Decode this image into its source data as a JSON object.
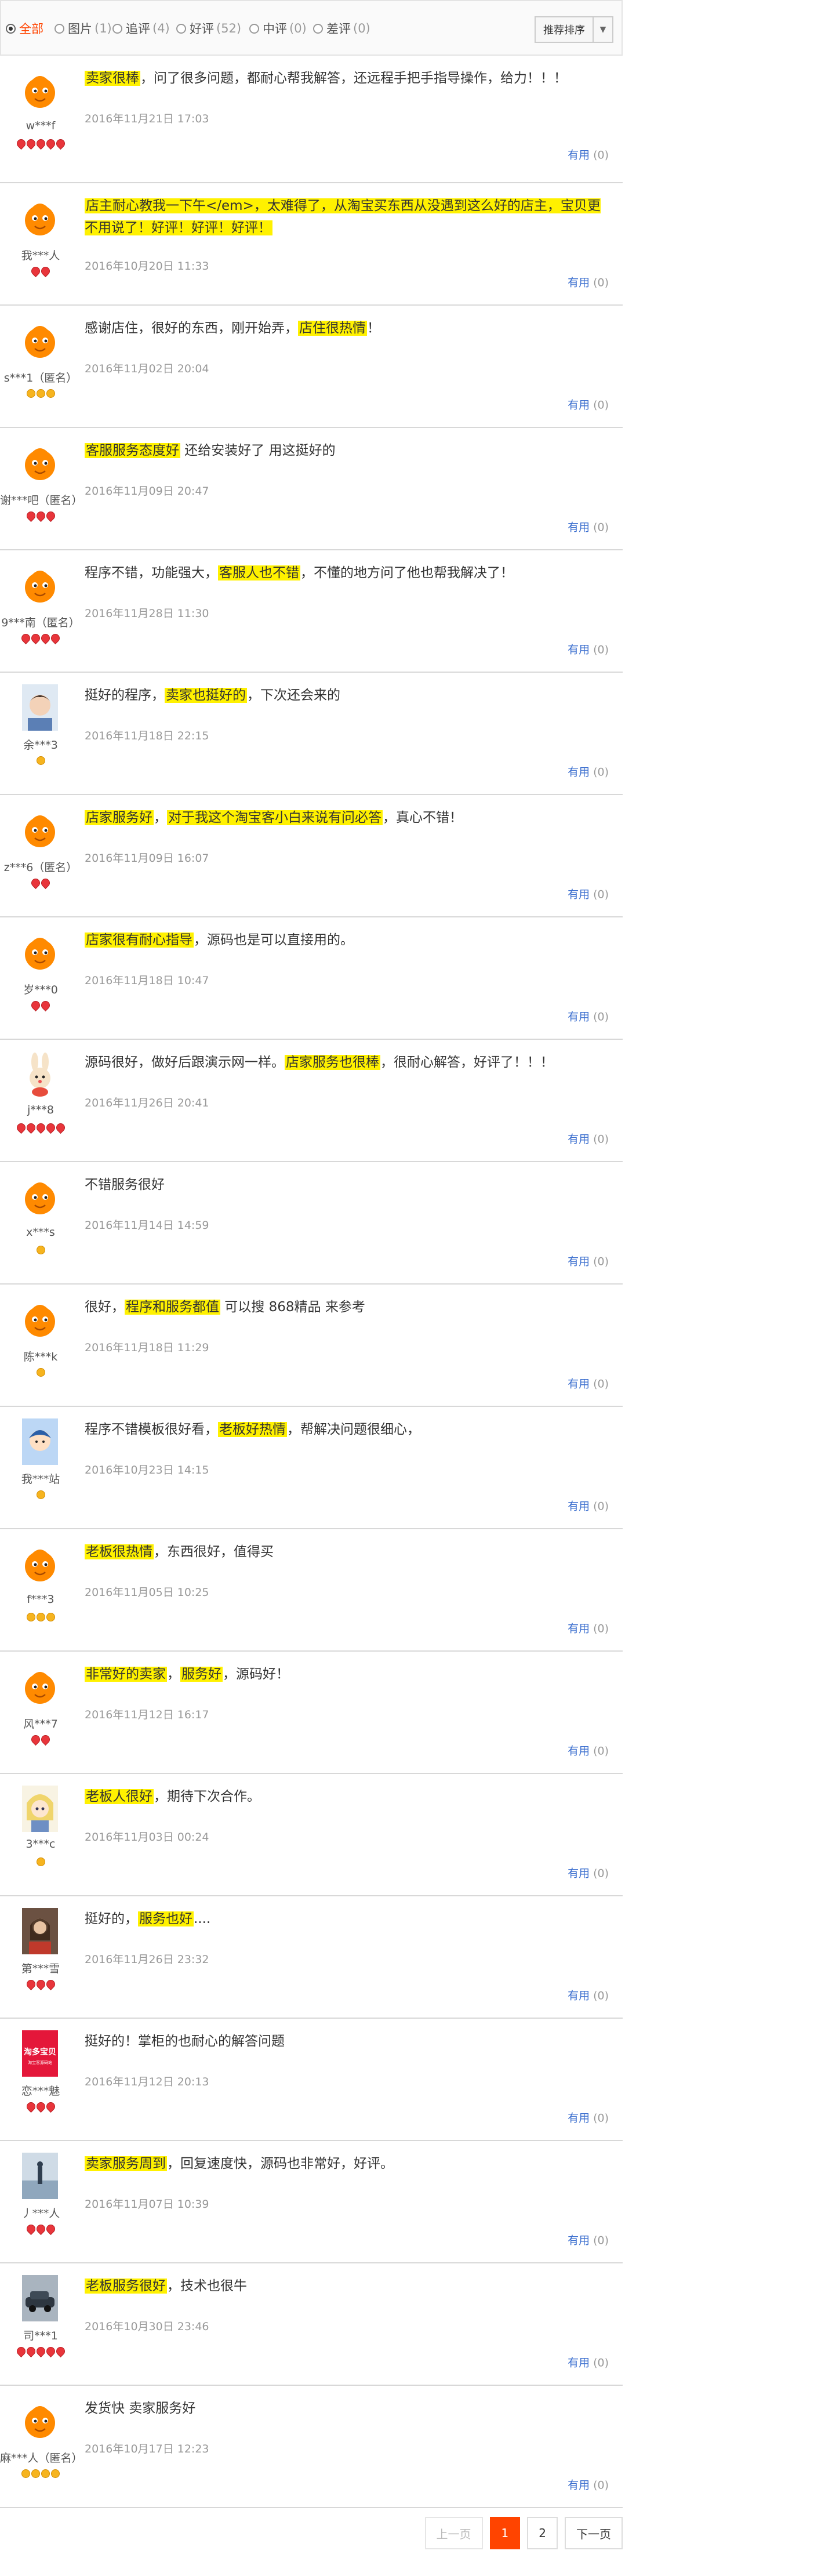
{
  "filters": [
    {
      "label": "全部",
      "count": "",
      "active": true
    },
    {
      "label": "图片",
      "count": "(1)",
      "active": false
    },
    {
      "label": "追评",
      "count": "(4)",
      "active": false
    },
    {
      "label": "好评",
      "count": "(52)",
      "active": false
    },
    {
      "label": "中评",
      "count": "(0)",
      "active": false
    },
    {
      "label": "差评",
      "count": "(0)",
      "active": false
    }
  ],
  "sort": {
    "label": "推荐排序",
    "arrow": "▼"
  },
  "useful_label": "有用",
  "reviews": [
    {
      "user": "w***f",
      "level": 5,
      "tier": "red",
      "avatar": "mascot",
      "date": "2016年11月21日 17:03",
      "useful": "(0)",
      "segments": [
        {
          "t": "卖家很棒",
          "h": true
        },
        {
          "t": "，问了很多问题，都耐心帮我解答，还远程手把手指导操作，给力！！！",
          "h": false
        }
      ]
    },
    {
      "user": "我***人",
      "level": 2,
      "tier": "red",
      "avatar": "mascot",
      "date": "2016年10月20日 11:33",
      "useful": "(0)",
      "tall": true,
      "segments": [
        {
          "t": "店主耐心教我一下午</em>，太难得了，从淘宝买东西从没遇到这么好的店主，宝贝更不用说了！好评！好评！好评！",
          "h": true
        }
      ]
    },
    {
      "user": "s***1（匿名）",
      "level": 3,
      "tier": "gold",
      "avatar": "mascot",
      "date": "2016年11月02日 20:04",
      "useful": "(0)",
      "segments": [
        {
          "t": "感谢店住，很好的东西，刚开始弄，",
          "h": false
        },
        {
          "t": "店住很热情",
          "h": true
        },
        {
          "t": "！",
          "h": false
        }
      ]
    },
    {
      "user": "谢***吧（匿名）",
      "level": 3,
      "tier": "red",
      "avatar": "mascot",
      "date": "2016年11月09日 20:47",
      "useful": "(0)",
      "segments": [
        {
          "t": "客服服务态度好",
          "h": true
        },
        {
          "t": " 还给安装好了 用这挺好的",
          "h": false
        }
      ]
    },
    {
      "user": "9***南（匿名）",
      "level": 4,
      "tier": "red",
      "avatar": "mascot",
      "date": "2016年11月28日 11:30",
      "useful": "(0)",
      "segments": [
        {
          "t": "程序不错，功能强大，",
          "h": false
        },
        {
          "t": "客服人也不错",
          "h": true
        },
        {
          "t": "，不懂的地方问了他也帮我解决了！",
          "h": false
        }
      ]
    },
    {
      "user": "余***3",
      "level": 1,
      "tier": "gold",
      "avatar": "boy",
      "date": "2016年11月18日 22:15",
      "useful": "(0)",
      "segments": [
        {
          "t": "挺好的程序，",
          "h": false
        },
        {
          "t": "卖家也挺好的",
          "h": true
        },
        {
          "t": "，下次还会来的",
          "h": false
        }
      ]
    },
    {
      "user": "z***6（匿名）",
      "level": 2,
      "tier": "red",
      "avatar": "mascot",
      "date": "2016年11月09日 16:07",
      "useful": "(0)",
      "segments": [
        {
          "t": "店家服务好",
          "h": true
        },
        {
          "t": "，",
          "h": false
        },
        {
          "t": "对于我这个淘宝客小白来说有问必答",
          "h": true
        },
        {
          "t": "，真心不错！",
          "h": false
        }
      ]
    },
    {
      "user": "岁***0",
      "level": 2,
      "tier": "red",
      "avatar": "mascot",
      "date": "2016年11月18日 10:47",
      "useful": "(0)",
      "segments": [
        {
          "t": "店家很有耐心指导",
          "h": true
        },
        {
          "t": "，源码也是可以直接用的。",
          "h": false
        }
      ]
    },
    {
      "user": "j***8",
      "level": 5,
      "tier": "red",
      "avatar": "bunny",
      "date": "2016年11月26日 20:41",
      "useful": "(0)",
      "segments": [
        {
          "t": "源码很好，做好后跟演示网一样。",
          "h": false
        },
        {
          "t": "店家服务也很棒",
          "h": true
        },
        {
          "t": "，很耐心解答，好评了！！！",
          "h": false
        }
      ]
    },
    {
      "user": "x***s",
      "level": 1,
      "tier": "gold",
      "avatar": "mascot",
      "date": "2016年11月14日 14:59",
      "useful": "(0)",
      "segments": [
        {
          "t": "不错服务很好",
          "h": false
        }
      ]
    },
    {
      "user": "陈***k",
      "level": 1,
      "tier": "gold",
      "avatar": "mascot",
      "date": "2016年11月18日 11:29",
      "useful": "(0)",
      "segments": [
        {
          "t": "很好，",
          "h": false
        },
        {
          "t": "程序和服务都值",
          "h": true
        },
        {
          "t": " 可以搜 868精品 来参考",
          "h": false
        }
      ]
    },
    {
      "user": "我***站",
      "level": 1,
      "tier": "gold",
      "avatar": "kid",
      "date": "2016年10月23日 14:15",
      "useful": "(0)",
      "segments": [
        {
          "t": "程序不错模板很好看，",
          "h": false
        },
        {
          "t": "老板好热情",
          "h": true
        },
        {
          "t": "，帮解决问题很细心，",
          "h": false
        }
      ]
    },
    {
      "user": "f***3",
      "level": 3,
      "tier": "gold",
      "avatar": "mascot",
      "date": "2016年11月05日 10:25",
      "useful": "(0)",
      "segments": [
        {
          "t": "老板很热情",
          "h": true
        },
        {
          "t": "，东西很好，值得买",
          "h": false
        }
      ]
    },
    {
      "user": "风***7",
      "level": 2,
      "tier": "red",
      "avatar": "mascot",
      "date": "2016年11月12日 16:17",
      "useful": "(0)",
      "segments": [
        {
          "t": "非常好的卖家",
          "h": true
        },
        {
          "t": "，",
          "h": false
        },
        {
          "t": "服务好",
          "h": true
        },
        {
          "t": "，源码好！",
          "h": false
        }
      ]
    },
    {
      "user": "3***c",
      "level": 1,
      "tier": "gold",
      "avatar": "anime",
      "date": "2016年11月03日 00:24",
      "useful": "(0)",
      "segments": [
        {
          "t": "老板人很好",
          "h": true
        },
        {
          "t": "，期待下次合作。",
          "h": false
        }
      ]
    },
    {
      "user": "第***雪",
      "level": 3,
      "tier": "red",
      "avatar": "photo",
      "date": "2016年11月26日 23:32",
      "useful": "(0)",
      "segments": [
        {
          "t": "挺好的，",
          "h": false
        },
        {
          "t": "服务也好",
          "h": true
        },
        {
          "t": "....",
          "h": false
        }
      ]
    },
    {
      "user": "恋***魅",
      "level": 3,
      "tier": "red",
      "avatar": "logo",
      "date": "2016年11月12日 20:13",
      "useful": "(0)",
      "segments": [
        {
          "t": "挺好的！掌柜的也耐心的解答问题",
          "h": false
        }
      ]
    },
    {
      "user": "丿***人",
      "level": 3,
      "tier": "red",
      "avatar": "photo2",
      "date": "2016年11月07日 10:39",
      "useful": "(0)",
      "segments": [
        {
          "t": "卖家服务周到",
          "h": true
        },
        {
          "t": "，回复速度快，源码也非常好，好评。",
          "h": false
        }
      ]
    },
    {
      "user": "司***1",
      "level": 5,
      "tier": "red",
      "avatar": "car",
      "date": "2016年10月30日 23:46",
      "useful": "(0)",
      "segments": [
        {
          "t": "老板服务很好",
          "h": true
        },
        {
          "t": "，技术也很牛",
          "h": false
        }
      ]
    },
    {
      "user": "麻***人（匿名）",
      "level": 4,
      "tier": "gold",
      "avatar": "mascot",
      "date": "2016年10月17日 12:23",
      "useful": "(0)",
      "segments": [
        {
          "t": "发货快 卖家服务好",
          "h": false
        }
      ]
    }
  ],
  "pagination": {
    "prev": "上一页",
    "pages": [
      "1",
      "2"
    ],
    "current": "1",
    "next": "下一页"
  },
  "logo_avatar": {
    "title": "淘多宝贝",
    "subtitle": "淘宝客源码站"
  },
  "colors": {
    "highlight": "#fff100",
    "accent": "#ff4400",
    "link": "#3c6fcf"
  }
}
